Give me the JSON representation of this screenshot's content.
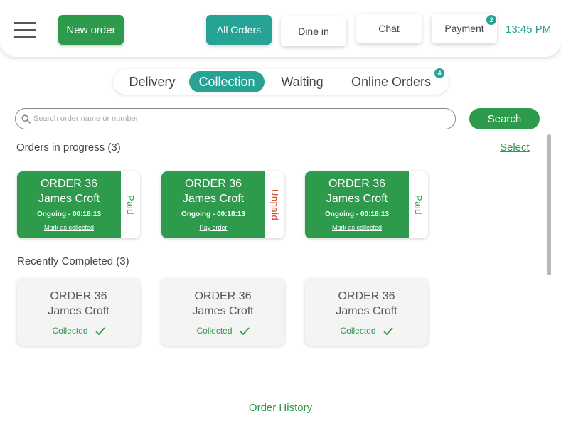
{
  "header": {
    "new_order_label": "New order",
    "tabs": [
      {
        "label": "All Orders",
        "active": true
      },
      {
        "label": "Dine in",
        "active": false
      },
      {
        "label": "Chat",
        "active": false
      },
      {
        "label": "Payment",
        "active": false,
        "badge": "2"
      }
    ],
    "time": "13:45 PM"
  },
  "segments": [
    {
      "label": "Delivery",
      "active": false
    },
    {
      "label": "Collection",
      "active": true
    },
    {
      "label": "Waiting",
      "active": false
    },
    {
      "label": "Online Orders",
      "active": false,
      "badge": "4"
    }
  ],
  "search": {
    "placeholder": "Search order name or number",
    "button_label": "Search"
  },
  "in_progress": {
    "title": "Orders in progress (3)",
    "select_label": "Select",
    "cards": [
      {
        "order": "ORDER 36",
        "name": "James Croft",
        "status": "Ongoing - 00:18:13",
        "action": "Mark as collected",
        "payment": "Paid"
      },
      {
        "order": "ORDER 36",
        "name": "James Croft",
        "status": "Ongoing - 00:18:13",
        "action": "Pay order",
        "payment": "Unpaid"
      },
      {
        "order": "ORDER 36",
        "name": "James Croft",
        "status": "Ongoing - 00:18:13",
        "action": "Mark as collected",
        "payment": "Paid"
      }
    ]
  },
  "completed": {
    "title": "Recently Completed (3)",
    "cards": [
      {
        "order": "ORDER 36",
        "name": "James Croft",
        "status": "Collected"
      },
      {
        "order": "ORDER 36",
        "name": "James Croft",
        "status": "Collected"
      },
      {
        "order": "ORDER 36",
        "name": "James Croft",
        "status": "Collected"
      }
    ]
  },
  "footer": {
    "history_label": "Order History"
  },
  "colors": {
    "primary_green": "#2e9a4c",
    "teal": "#26a394",
    "unpaid_red": "#d2451e"
  },
  "icons": {
    "menu": "hamburger-icon",
    "search": "search-icon",
    "check": "check-icon"
  }
}
